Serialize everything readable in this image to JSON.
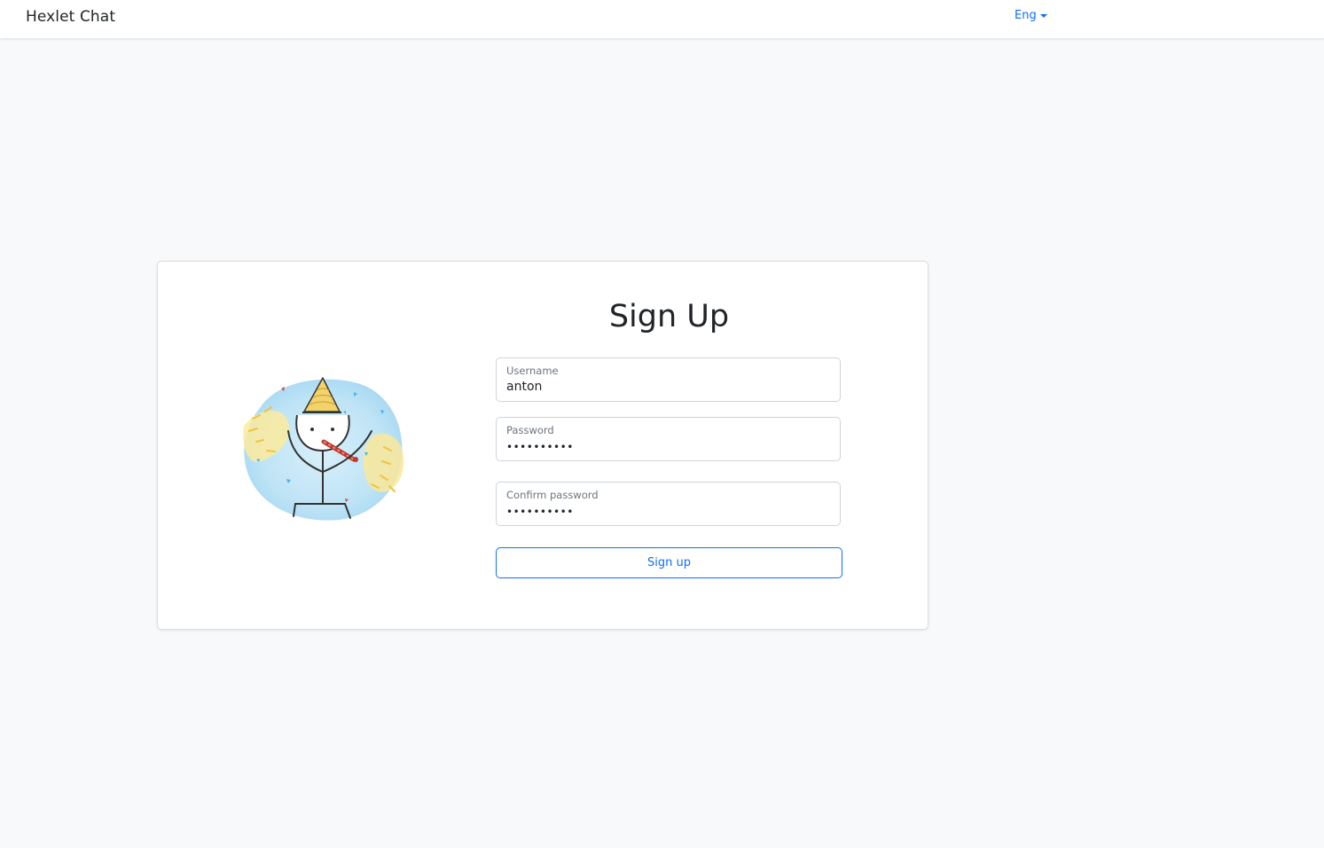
{
  "navbar": {
    "brand": "Hexlet Chat",
    "language": "Eng",
    "language_icon": "caret-down-icon"
  },
  "signup": {
    "title": "Sign Up",
    "illustration_icon": "party-stick-figure-illustration",
    "username": {
      "label": "Username",
      "value": "anton"
    },
    "password": {
      "label": "Password",
      "value": "••••••••••"
    },
    "confirm_password": {
      "label": "Confirm password",
      "value": "••••••••••"
    },
    "submit_label": "Sign up"
  },
  "colors": {
    "accent": "#0d6efd",
    "page_background": "#f8f9fa",
    "card_background": "#ffffff",
    "border": "#ced4da"
  }
}
